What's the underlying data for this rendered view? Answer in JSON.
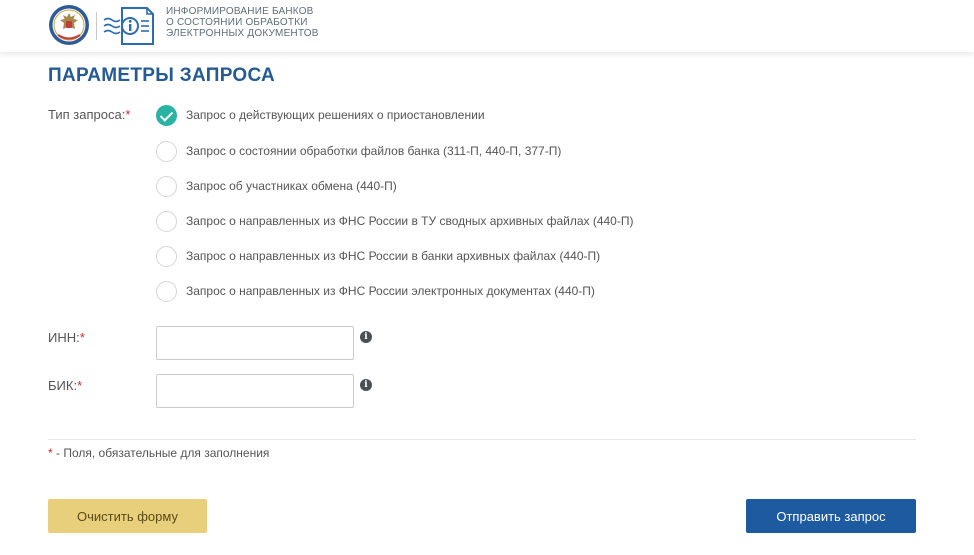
{
  "header": {
    "title": "Информирование банков\nо состоянии обработки\nэлектронных документов",
    "emblem_icon": "fns-eagle-emblem-icon",
    "doc_icon": "document-info-icon"
  },
  "page_title": "Параметры запроса",
  "request_type": {
    "label": "Тип запроса:",
    "required_mark": "*",
    "selected_index": 0,
    "options": [
      "Запрос о действующих решениях о приостановлении",
      "Запрос о состоянии обработки файлов банка (311-П, 440-П, 377-П)",
      "Запрос об участниках обмена (440-П)",
      "Запрос о направленных из ФНС России в ТУ сводных архивных файлах (440-П)",
      "Запрос о направленных из ФНС России в банки архивных файлах (440-П)",
      "Запрос о направленных из ФНС России электронных документах (440-П)"
    ]
  },
  "inn": {
    "label": "ИНН:",
    "required_mark": "*",
    "value": "",
    "info_glyph": "i"
  },
  "bik": {
    "label": "БИК:",
    "required_mark": "*",
    "value": "",
    "info_glyph": "i"
  },
  "footnote": {
    "mark": "*",
    "text": " - Поля, обязательные для заполнения"
  },
  "buttons": {
    "clear_label": "Очистить форму",
    "submit_label": "Отправить запрос"
  },
  "colors": {
    "brand_blue": "#245a96",
    "accent_teal": "#2ab2a4",
    "button_yellow": "#e8cf7c",
    "button_blue": "#1e5aa0",
    "required_red": "#d22a2a"
  }
}
